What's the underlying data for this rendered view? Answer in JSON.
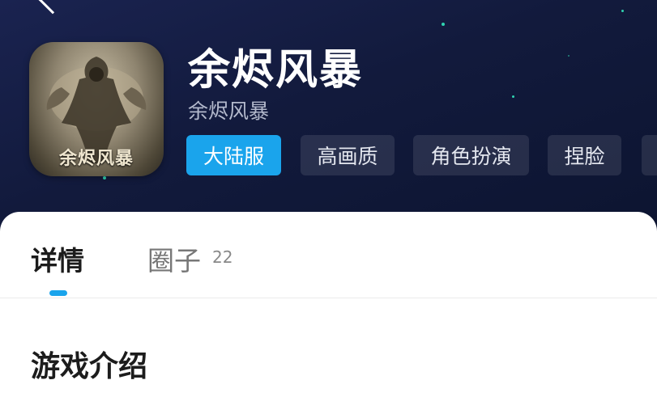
{
  "game": {
    "title": "余烬风暴",
    "subtitle": "余烬风暴",
    "icon_caption": "余烬风暴"
  },
  "tags": [
    {
      "label": "大陆服",
      "active": true
    },
    {
      "label": "高画质",
      "active": false
    },
    {
      "label": "角色扮演",
      "active": false
    },
    {
      "label": "捏脸",
      "active": false
    }
  ],
  "tabs": [
    {
      "label": "详情",
      "active": true
    },
    {
      "label": "圈子",
      "count": "22",
      "active": false
    }
  ],
  "section": {
    "title": "游戏介绍"
  },
  "colors": {
    "accent": "#1aa4ec",
    "header_bg": "#121a3c",
    "star": "#2fd3b0"
  },
  "icons": [
    "back-arrow-icon",
    "game-icon"
  ]
}
